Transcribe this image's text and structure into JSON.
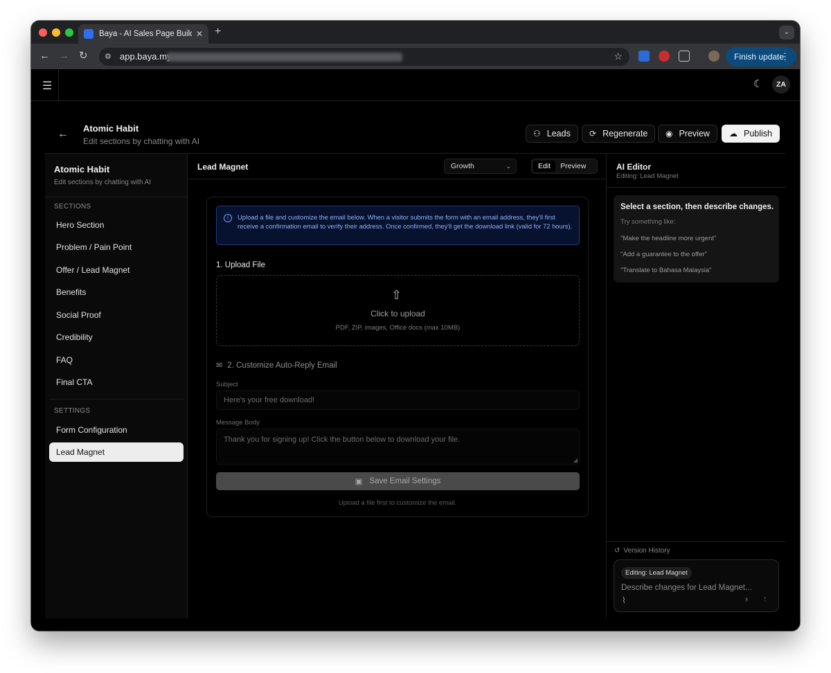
{
  "browser": {
    "tab_title": "Baya - AI Sales Page Builder",
    "url": "app.baya.my",
    "finish_update": "Finish update",
    "avatar_initials": "ZA"
  },
  "header": {
    "title": "Atomic Habit",
    "subtitle": "Edit sections by chatting with AI",
    "buttons": {
      "leads": "Leads",
      "regenerate": "Regenerate",
      "preview": "Preview",
      "publish": "Publish"
    }
  },
  "sidebar": {
    "title": "Atomic Habit",
    "subtitle": "Edit sections by chatting with AI",
    "sections_label": "SECTIONS",
    "sections": [
      "Hero Section",
      "Problem / Pain Point",
      "Offer / Lead Magnet",
      "Benefits",
      "Social Proof",
      "Credibility",
      "FAQ",
      "Final CTA"
    ],
    "settings_label": "SETTINGS",
    "settings": [
      "Form Configuration",
      "Lead Magnet"
    ],
    "active": "Lead Magnet"
  },
  "main": {
    "title": "Lead Magnet",
    "theme_select": "Growth",
    "toggle": {
      "edit": "Edit",
      "preview": "Preview",
      "active": "Edit"
    },
    "info_text": "Upload a file and customize the email below. When a visitor submits the form with an email address, they'll first receive a confirmation email to verify their address. Once confirmed, they'll get the download link (valid for 72 hours).",
    "upload_label": "1. Upload File",
    "upload_title": "Click to upload",
    "upload_sub": "PDF, ZIP, images, Office docs (max 10MB)",
    "email_label": "2. Customize Auto-Reply Email",
    "subject_label": "Subject",
    "subject_placeholder": "Here's your free download!",
    "body_label": "Message Body",
    "body_placeholder": "Thank you for signing up! Click the button below to download your file.",
    "save_button": "Save Email Settings",
    "note": "Upload a file first to customize the email."
  },
  "ai_editor": {
    "title": "AI Editor",
    "subtitle": "Editing: Lead Magnet",
    "tips_head": "Select a section, then describe changes.",
    "tips_sub": "Try something like:",
    "examples": [
      "\"Make the headline more urgent\"",
      "\"Add a guarantee to the offer\"",
      "\"Translate to Bahasa Malaysia\""
    ],
    "version_history": "Version History",
    "chip": "Editing: Lead Magnet",
    "input_placeholder": "Describe changes for Lead Magnet..."
  },
  "colors": {
    "accent_blue": "#0b4a7a",
    "info_border": "#1e3a8a",
    "info_text": "#8fb1ff"
  }
}
